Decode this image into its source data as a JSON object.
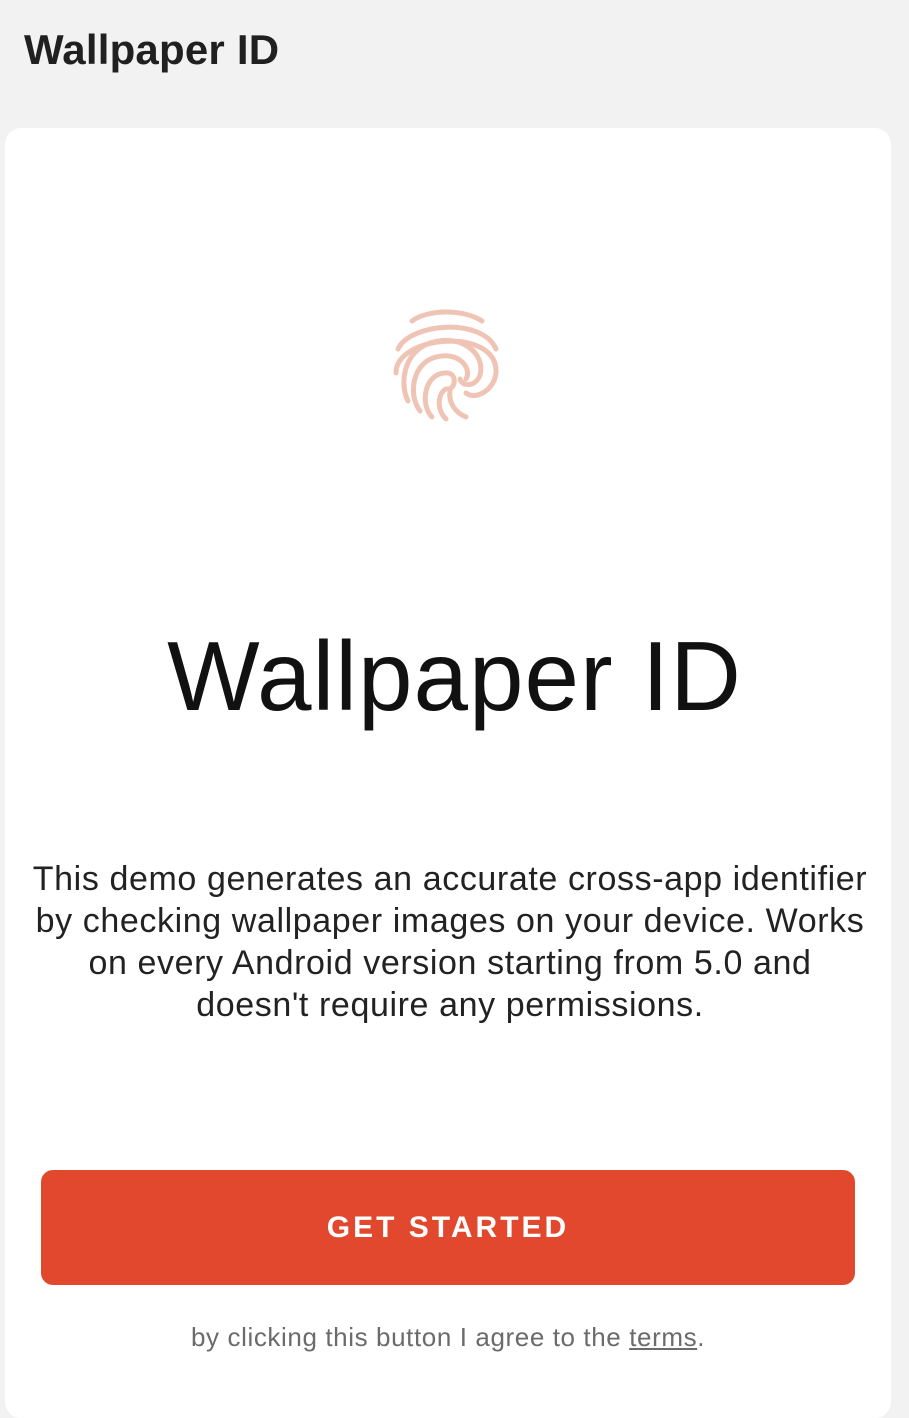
{
  "app_bar": {
    "title": "Wallpaper ID"
  },
  "hero": {
    "icon": "fingerprint-icon",
    "title": "Wallpaper ID",
    "description": "This demo generates an accurate cross-app identifier by checking wallpaper images on your device. Works on every Android version starting from 5.0 and doesn't require any permissions."
  },
  "cta": {
    "label": "GET STARTED"
  },
  "footer": {
    "prefix": "by clicking this button I agree to the ",
    "terms_link": "terms",
    "suffix": "."
  },
  "colors": {
    "accent": "#e2482e",
    "icon_tint": "#f0c4b4",
    "background": "#f2f2f2",
    "card": "#ffffff"
  }
}
